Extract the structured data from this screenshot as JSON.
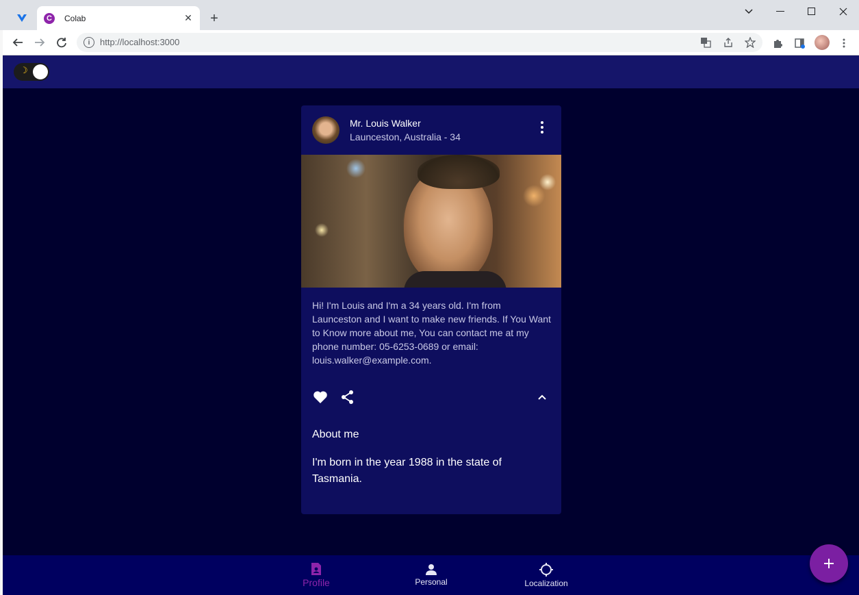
{
  "browser": {
    "tab_title": "Colab",
    "tab_favicon_letter": "C",
    "new_tab_label": "+",
    "url": "http://localhost:3000"
  },
  "theme_toggle": {
    "icon": "moon-icon",
    "state": "dark"
  },
  "profile_card": {
    "name": "Mr. Louis Walker",
    "location": "Launceston, Australia - 34",
    "bio": "Hi! I'm Louis and I'm a 34 years old. I'm from Launceston and I want to make new friends. If You Want to Know more about me, You can contact me at my phone number: 05-6253-0689 or email: louis.walker@example.com.",
    "about_title": "About me",
    "about_text": "I'm born in the year 1988 in the state of Tasmania."
  },
  "bottom_nav": {
    "items": [
      {
        "label": "Profile",
        "icon": "profile-badge-icon",
        "active": true
      },
      {
        "label": "Personal",
        "icon": "person-icon",
        "active": false
      },
      {
        "label": "Localization",
        "icon": "crosshair-icon",
        "active": false
      }
    ]
  },
  "fab": {
    "icon": "plus-icon"
  },
  "colors": {
    "app_background": "#00002e",
    "app_bar": "#15156a",
    "card": "#0e0e5e",
    "bottom_nav": "#000060",
    "accent": "#8e24aa"
  }
}
